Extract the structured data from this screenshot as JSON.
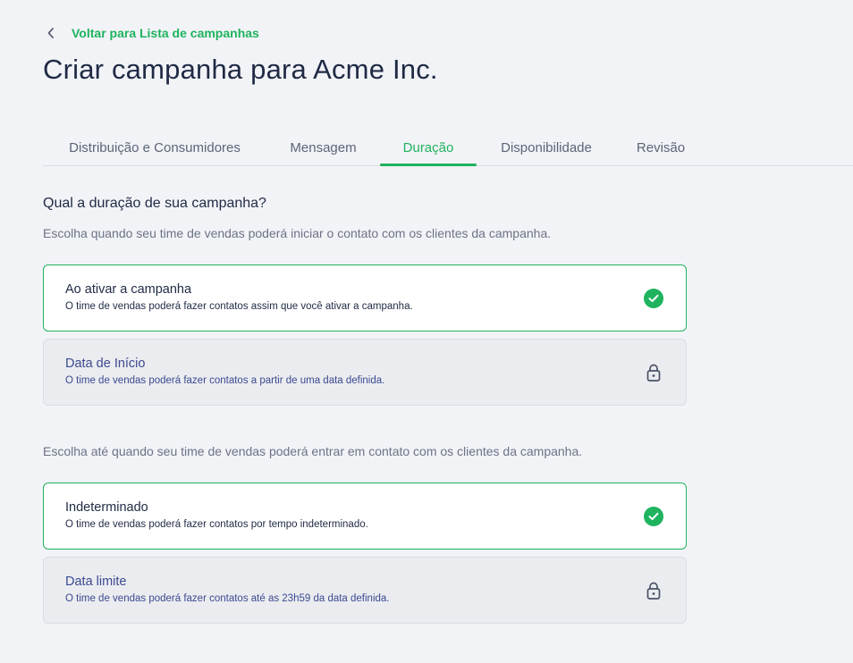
{
  "back_link": {
    "icon": "chevron-left-icon",
    "label": "Voltar para Lista de campanhas"
  },
  "page_title": "Criar campanha para Acme Inc.",
  "tabs": [
    {
      "label": "Distribuição e Consumidores",
      "active": false
    },
    {
      "label": "Mensagem",
      "active": false
    },
    {
      "label": "Duração",
      "active": true
    },
    {
      "label": "Disponibilidade",
      "active": false
    },
    {
      "label": "Revisão",
      "active": false
    }
  ],
  "duration": {
    "title": "Qual a duração de sua campanha?",
    "start_subtitle": "Escolha quando seu time de vendas poderá iniciar o contato com os clientes da campanha.",
    "start_options": [
      {
        "title": "Ao ativar a campanha",
        "description": "O time de vendas poderá fazer contatos assim que você ativar a campanha.",
        "state": "selected",
        "icon": "check-circle-icon"
      },
      {
        "title": "Data de Início",
        "description": "O time de vendas poderá fazer contatos a partir de uma data definida.",
        "state": "locked",
        "icon": "lock-icon"
      }
    ],
    "end_subtitle": "Escolha até quando seu time de vendas poderá entrar em contato com os clientes da campanha.",
    "end_options": [
      {
        "title": "Indeterminado",
        "description": "O time de vendas poderá fazer contatos por tempo indeterminado.",
        "state": "selected",
        "icon": "check-circle-icon"
      },
      {
        "title": "Data limite",
        "description": "O time de vendas poderá fazer contatos até as 23h59 da data definida.",
        "state": "locked",
        "icon": "lock-icon"
      }
    ]
  },
  "colors": {
    "accent": "#1fb35e",
    "title_text": "#1f2a44",
    "locked_text": "#3b4a8f",
    "background": "#f2f3f7"
  }
}
